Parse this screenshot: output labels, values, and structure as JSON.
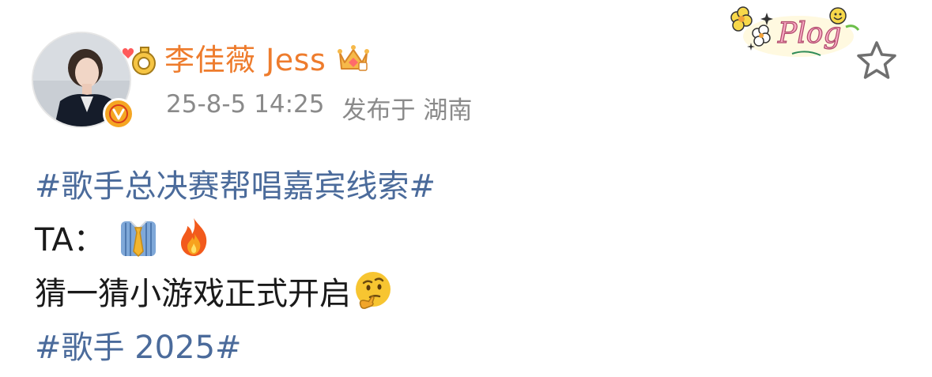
{
  "author": {
    "name": "李佳薇 Jess",
    "badge_icon": "vip-crown-icon",
    "verified_icon": "verified-v-icon",
    "avatar_icon": "user-avatar"
  },
  "meta": {
    "time": "25-8-5 14:25",
    "location": "发布于 湖南"
  },
  "decorations": {
    "sticker_text": "Plog",
    "favorite_icon": "star-outline-icon"
  },
  "post": {
    "hashtag1": "#歌手总决赛帮唱嘉宾线索#",
    "line2_prefix": "TA：",
    "line2_emojis": [
      "necktie-shirt-emoji",
      "fire-emoji"
    ],
    "line3_text": "猜一猜小游戏正式开启",
    "line3_emoji": "thinking-face-emoji",
    "hashtag2": "#歌手 2025#"
  },
  "colors": {
    "username": "#ee7c2d",
    "hashtag": "#4b6b9b",
    "meta": "#8a8a8a",
    "verified": "#f5a623"
  }
}
